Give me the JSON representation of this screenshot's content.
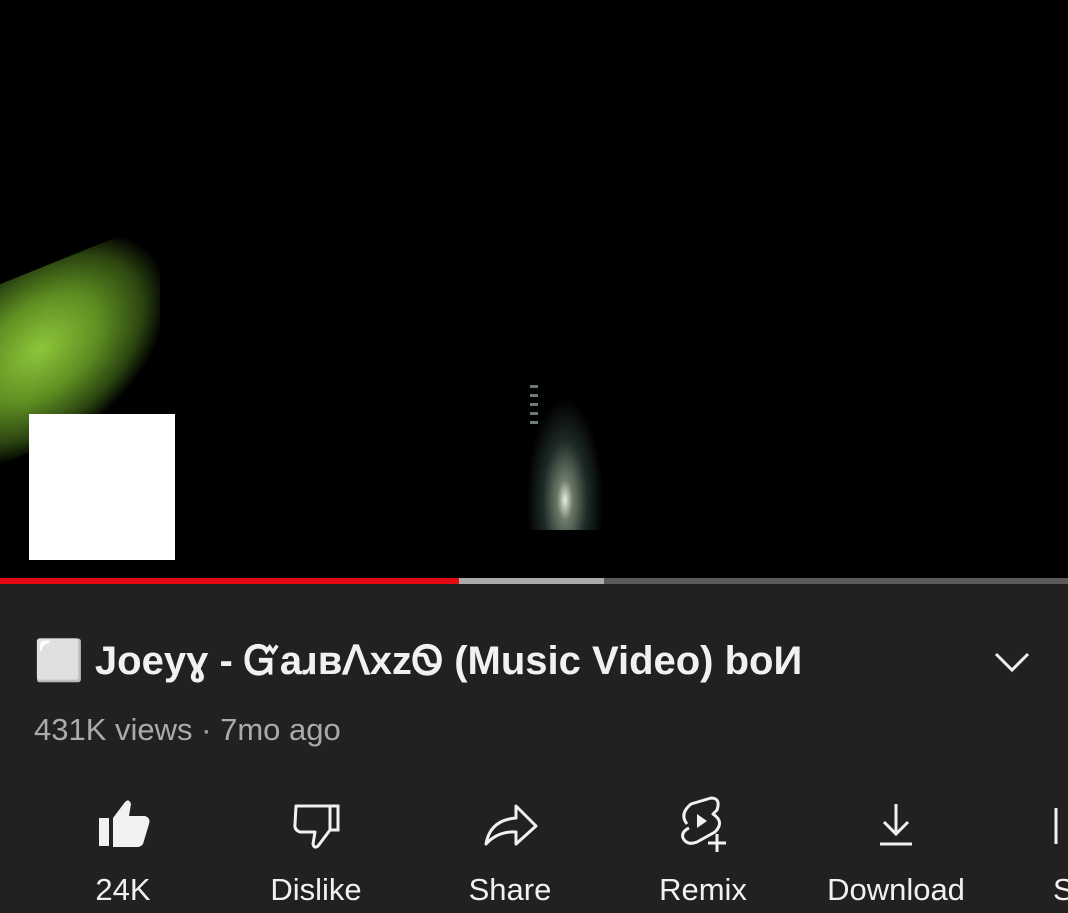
{
  "video": {
    "progress_played": 0.43,
    "progress_buffered": 0.566
  },
  "title_prefix_icon": "white-square-icon",
  "title": "⬜ Joeyɣ - ᏳaɹʙᐱxzᏫ (Music Video) boИ",
  "meta": "431K views · 7mo ago",
  "actions": [
    {
      "label": "24K",
      "icon": "thumbs-up-filled-icon"
    },
    {
      "label": "Dislike",
      "icon": "thumbs-down-icon"
    },
    {
      "label": "Share",
      "icon": "share-arrow-icon"
    },
    {
      "label": "Remix",
      "icon": "remix-icon"
    },
    {
      "label": "Download",
      "icon": "download-icon"
    }
  ],
  "partial_action_label": "S",
  "colors": {
    "progress_played": "#e50914",
    "progress_buffered": "#aaaaaa",
    "background": "#212121"
  }
}
